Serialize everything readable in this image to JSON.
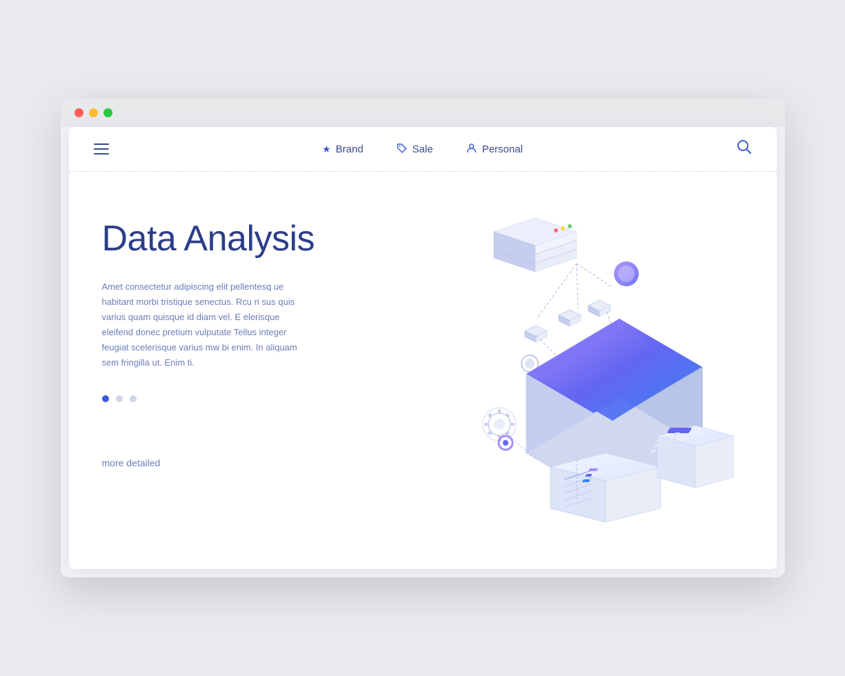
{
  "browser": {
    "titlebar": {
      "dots": [
        "red",
        "yellow",
        "green"
      ]
    }
  },
  "navbar": {
    "hamburger_label": "menu",
    "items": [
      {
        "id": "brand",
        "icon": "★",
        "label": "Brand"
      },
      {
        "id": "sale",
        "icon": "🏷",
        "label": "Sale"
      },
      {
        "id": "personal",
        "icon": "👤",
        "label": "Personal"
      }
    ],
    "search_label": "🔍"
  },
  "hero": {
    "title": "Data Analysis",
    "description": "Amet consectetur adipiscing elit pellentesq ue habitant morbi tristique senectus. Rcu ri sus quis varius quam quisque id diam vel. E elerisque eleifend donec pretium vulputate Tellus integer feugiat scelerisque varius mw bi enim. In aliquam sem fringilla ut. Enim ti.",
    "more_link": "more detailed",
    "dots": [
      {
        "active": true
      },
      {
        "active": false
      },
      {
        "active": false
      }
    ]
  }
}
